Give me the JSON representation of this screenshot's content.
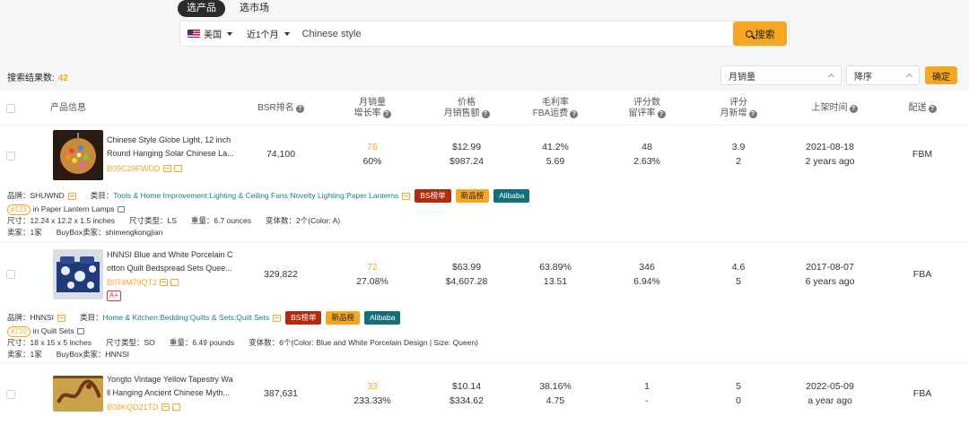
{
  "tabs": [
    {
      "label": "选产品",
      "active": true
    },
    {
      "label": "选市场",
      "active": false
    }
  ],
  "search": {
    "country": "美国",
    "period": "近1个月",
    "keyword": "Chinese style",
    "button": "搜索"
  },
  "results": {
    "label": "搜索结果数:",
    "count": "42"
  },
  "sort": {
    "field": "月销量",
    "order": "降序",
    "confirm": "确定"
  },
  "headers": {
    "product_info": "产品信息",
    "bsr": "BSR排名",
    "monthly_sales_1": "月销量",
    "monthly_sales_2": "增长率",
    "price_1": "价格",
    "price_2": "月销售额",
    "margin_1": "毛利率",
    "margin_2": "FBA运费",
    "reviews_1": "评分数",
    "reviews_2": "留评率",
    "rating_1": "评分",
    "rating_2": "月新增",
    "listed": "上架时间",
    "fulfillment": "配送"
  },
  "products": [
    {
      "title_line1": "Chinese Style Globe Light, 12 inch",
      "title_line2": "Round Hanging Solar Chinese La...",
      "asin": "B09C29FWDD",
      "bsr": "74,100",
      "sales": "76",
      "growth": "60%",
      "price": "$12.99",
      "revenue": "$987.24",
      "margin": "41.2%",
      "fba": "5.69",
      "reviews": "48",
      "review_rate": "2.63%",
      "rating": "3.9",
      "rating_new": "2",
      "date": "2021-08-18",
      "ago": "2 years ago",
      "fulfillment": "FBM",
      "brand": "品牌：SHUWND",
      "category_label": "类目：",
      "category": "Tools & Home Improvement:Lighting & Ceiling Fans:Novelty Lighting:Paper Lanterns",
      "rank": "#123",
      "rank_in": "in Paper Lantern Lamps",
      "size": "尺寸：12.24 x 12.2 x 1.5 inches",
      "size_type": "尺寸类型：LS",
      "weight": "重量：6.7 ounces",
      "variants": "变体数：2个(Color: A)",
      "sellers": "卖家：1家",
      "buybox": "BuyBox卖家：shimengkongjian",
      "aplus": false
    },
    {
      "title_line1": "HNNSI Blue and White Porcelain C",
      "title_line2": "otton Quilt Bedspread Sets Quee...",
      "asin": "B074M79QT2",
      "bsr": "329,822",
      "sales": "72",
      "growth": "27.08%",
      "price": "$63.99",
      "revenue": "$4,607.28",
      "margin": "63.89%",
      "fba": "13.51",
      "reviews": "346",
      "review_rate": "6.94%",
      "rating": "4.6",
      "rating_new": "5",
      "date": "2017-08-07",
      "ago": "6 years ago",
      "fulfillment": "FBA",
      "brand": "品牌：HNNSI",
      "category_label": "类目：",
      "category": "Home & Kitchen:Bedding:Quilts & Sets:Quilt Sets",
      "rank": "#710",
      "rank_in": "in Quilt Sets",
      "size": "尺寸：18 x 15 x 5 inches",
      "size_type": "尺寸类型：SO",
      "weight": "重量：6.49 pounds",
      "variants": "变体数：6个(Color: Blue and White Porcelain Design | Size: Queen)",
      "sellers": "卖家：1家",
      "buybox": "BuyBox卖家：HNNSI",
      "aplus": true,
      "aplus_label": "A+"
    },
    {
      "title_line1": "Yongto Vintage Yellow Tapestry Wa",
      "title_line2": "ll Hanging Ancient Chinese Myth...",
      "asin": "B08KQD21TD",
      "bsr": "387,631",
      "sales": "33",
      "growth": "233.33%",
      "price": "$10.14",
      "revenue": "$334.62",
      "margin": "38.16%",
      "fba": "4.75",
      "reviews": "1",
      "review_rate": "-",
      "rating": "5",
      "rating_new": "0",
      "date": "2022-05-09",
      "ago": "a year ago",
      "fulfillment": "FBA"
    }
  ],
  "tags": {
    "bs": "BS榜单",
    "new": "新品榜",
    "ali": "Alibaba"
  }
}
